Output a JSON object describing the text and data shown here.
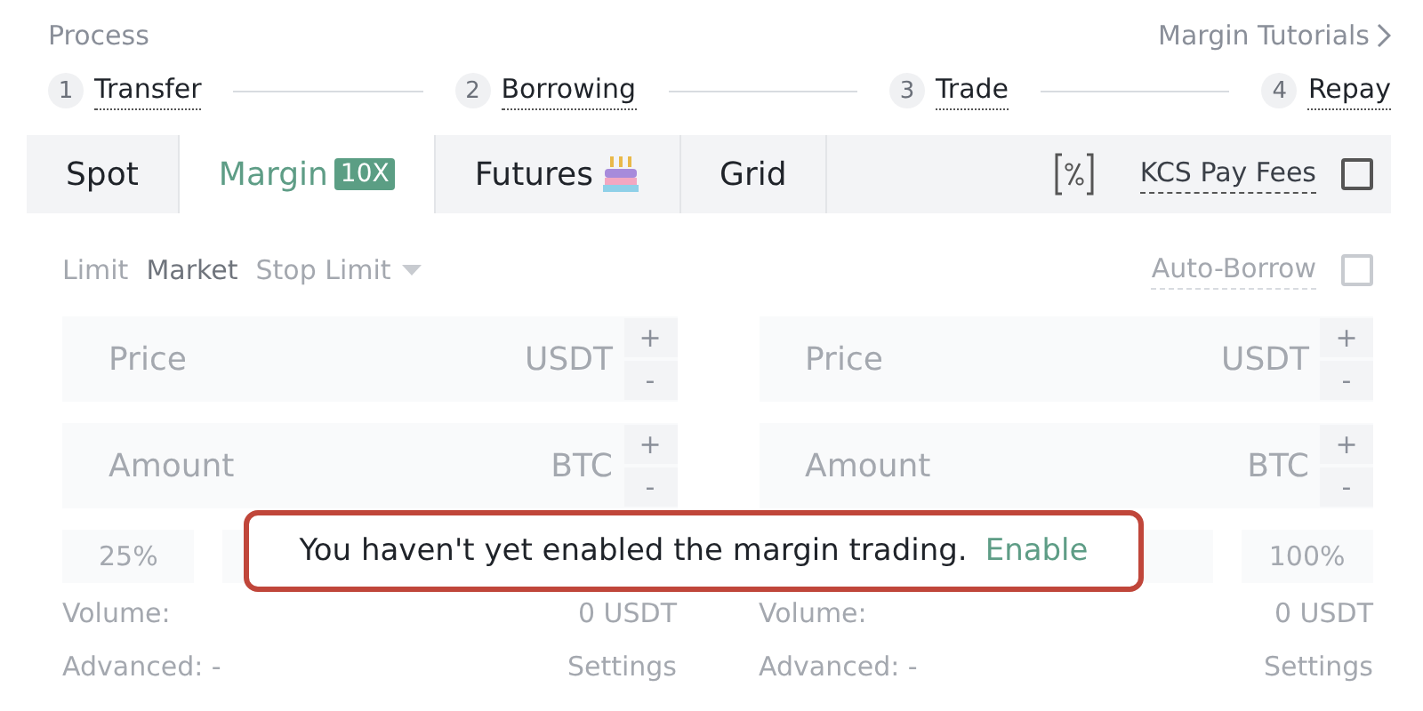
{
  "process": {
    "title": "Process",
    "tutorials_link": "Margin Tutorials",
    "steps": [
      {
        "number": "1",
        "label": "Transfer"
      },
      {
        "number": "2",
        "label": "Borrowing"
      },
      {
        "number": "3",
        "label": "Trade"
      },
      {
        "number": "4",
        "label": "Repay"
      }
    ]
  },
  "tabs": [
    {
      "label": "Spot",
      "selected": false
    },
    {
      "label": "Margin",
      "badge": "10X",
      "selected": true
    },
    {
      "label": "Futures",
      "kind": "icon",
      "selected": false
    },
    {
      "label": "Grid",
      "selected": false
    }
  ],
  "fee_option": {
    "label": "KCS Pay Fees",
    "checked": false
  },
  "order_types": [
    {
      "label": "Limit",
      "selected": false,
      "dropdown": false
    },
    {
      "label": "Market",
      "selected": true,
      "dropdown": false
    },
    {
      "label": "Stop Limit",
      "selected": false,
      "dropdown": true
    }
  ],
  "auto_borrow": {
    "label": "Auto-Borrow",
    "checked": false
  },
  "panels": [
    {
      "fields": [
        {
          "placeholder": "Price",
          "unit": "USDT",
          "plus": "+",
          "minus": "-"
        },
        {
          "placeholder": "Amount",
          "unit": "BTC",
          "plus": "+",
          "minus": "-"
        }
      ],
      "first_percent_button": "25%",
      "volume_label": "Volume:",
      "volume_value": "0 USDT",
      "advanced_label": "Advanced: -",
      "settings_link": "Settings"
    },
    {
      "fields": [
        {
          "placeholder": "Price",
          "unit": "USDT",
          "plus": "+",
          "minus": "-"
        },
        {
          "placeholder": "Amount",
          "unit": "BTC",
          "plus": "+",
          "minus": "-"
        }
      ],
      "last_percent_button": "100%",
      "volume_label": "Volume:",
      "volume_value": "0 USDT",
      "advanced_label": "Advanced: -",
      "settings_link": "Settings"
    }
  ],
  "notice": {
    "message": "You haven't yet enabled the margin trading.",
    "action": "Enable"
  }
}
